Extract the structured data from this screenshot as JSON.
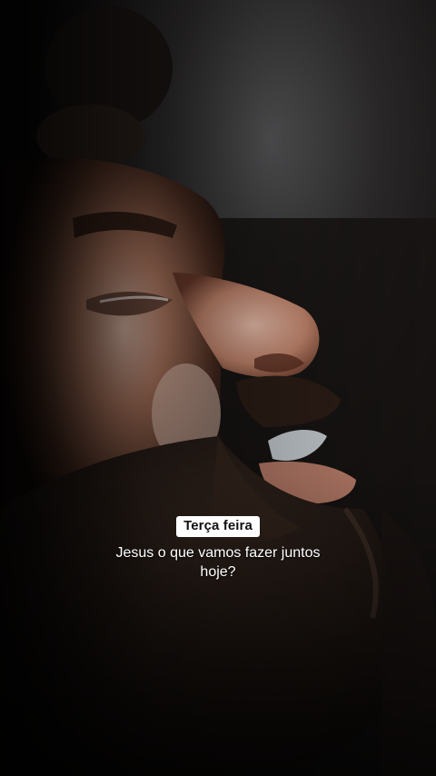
{
  "video": {
    "scene_description_icon": "man-praying-face-closeup",
    "accent_colors": {
      "tag_background": "#ffffff",
      "tag_text": "#111111",
      "caption_text": "#ffffff"
    }
  },
  "overlay": {
    "day_tag": "Terça feira",
    "caption": "Jesus o que vamos fazer juntos hoje?"
  }
}
